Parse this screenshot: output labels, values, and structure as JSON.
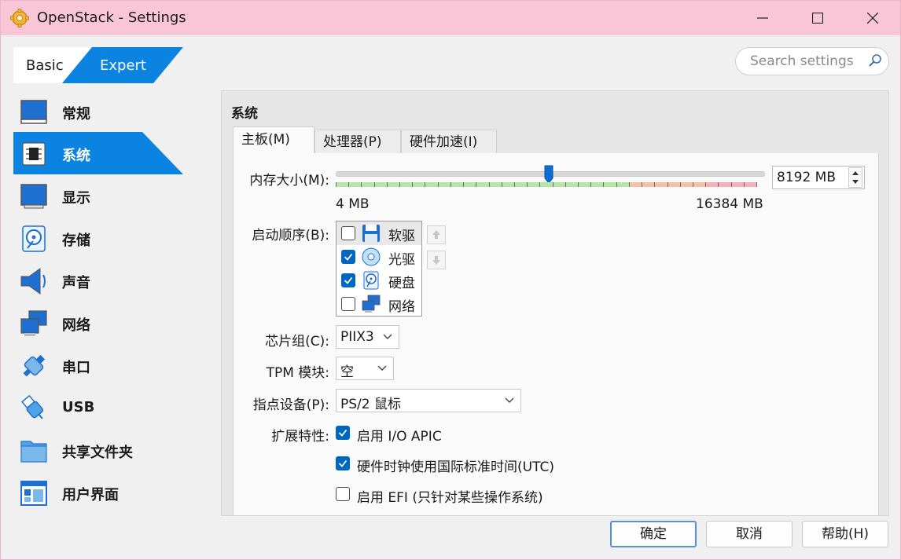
{
  "window": {
    "title": "OpenStack - Settings",
    "accent": "#0a84e0"
  },
  "mode_switch": {
    "basic": "Basic",
    "expert": "Expert",
    "active": "Expert"
  },
  "search": {
    "placeholder": "Search settings"
  },
  "sidebar": {
    "active": "系统",
    "items": [
      {
        "label": "常规",
        "icon": "monitor-icon"
      },
      {
        "label": "系统",
        "icon": "chip-icon"
      },
      {
        "label": "显示",
        "icon": "display-icon"
      },
      {
        "label": "存储",
        "icon": "disk-icon"
      },
      {
        "label": "声音",
        "icon": "speaker-icon"
      },
      {
        "label": "网络",
        "icon": "network-icon"
      },
      {
        "label": "串口",
        "icon": "serial-port-icon"
      },
      {
        "label": "USB",
        "icon": "usb-icon"
      },
      {
        "label": "共享文件夹",
        "icon": "folder-icon"
      },
      {
        "label": "用户界面",
        "icon": "window-layout-icon"
      }
    ]
  },
  "panel": {
    "title": "系统",
    "tabs": [
      "主板(M)",
      "处理器(P)",
      "硬件加速(I)"
    ],
    "active_tab": "主板(M)",
    "memory": {
      "label": "内存大小(M):",
      "value": "8192 MB",
      "value_mb": 8192,
      "min": "4 MB",
      "max": "16384 MB",
      "min_mb": 4,
      "max_mb": 16384
    },
    "boot_order": {
      "label": "启动顺序(B):",
      "items": [
        {
          "label": "软驱",
          "checked": false,
          "icon": "floppy-icon"
        },
        {
          "label": "光驱",
          "checked": true,
          "icon": "optical-disc-icon"
        },
        {
          "label": "硬盘",
          "checked": true,
          "icon": "hard-disk-icon"
        },
        {
          "label": "网络",
          "checked": false,
          "icon": "network-icon"
        }
      ]
    },
    "chipset": {
      "label": "芯片组(C):",
      "value": "PIIX3"
    },
    "tpm": {
      "label": "TPM 模块:",
      "value": "空"
    },
    "pointing": {
      "label": "指点设备(P):",
      "value": "PS/2 鼠标"
    },
    "features": {
      "label": "扩展特性:",
      "items": [
        {
          "label": "启用 I/O APIC",
          "checked": true
        },
        {
          "label": "硬件时钟使用国际标准时间(UTC)",
          "checked": true
        },
        {
          "label": "启用 EFI (只针对某些操作系统)",
          "checked": false
        }
      ]
    }
  },
  "buttons": {
    "ok": "确定",
    "cancel": "取消",
    "help": "帮助(H)"
  }
}
